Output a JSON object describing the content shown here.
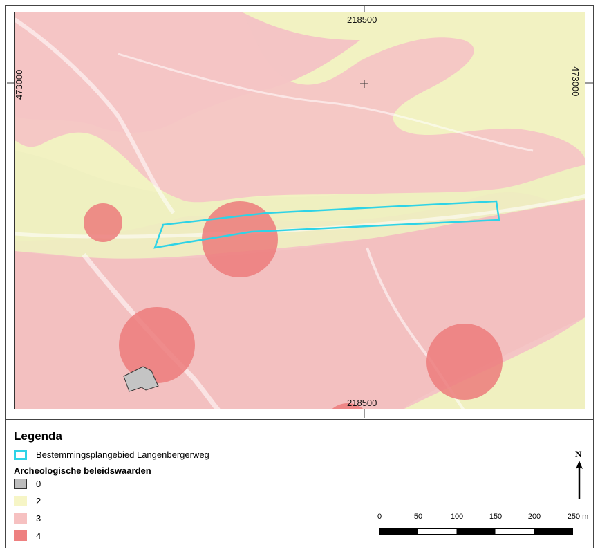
{
  "map": {
    "coord_top": "218500",
    "coord_bottom": "218500",
    "coord_left": "473000",
    "coord_right": "473000"
  },
  "legend": {
    "title": "Legenda",
    "boundary_label": "Bestemmingsplangebied Langenbergerweg",
    "boundary_color": "#2ed3e6",
    "values_title": "Archeologische beleidswaarden",
    "classes": [
      {
        "label": "0",
        "color": "#bdbdbd"
      },
      {
        "label": "2",
        "color": "#f6f5c6"
      },
      {
        "label": "3",
        "color": "#f6c1c1"
      },
      {
        "label": "4",
        "color": "#ee8080"
      }
    ]
  },
  "north_arrow": {
    "label": "N"
  },
  "scalebar": {
    "ticks": [
      "0",
      "50",
      "100",
      "150",
      "200",
      "250 m"
    ]
  }
}
